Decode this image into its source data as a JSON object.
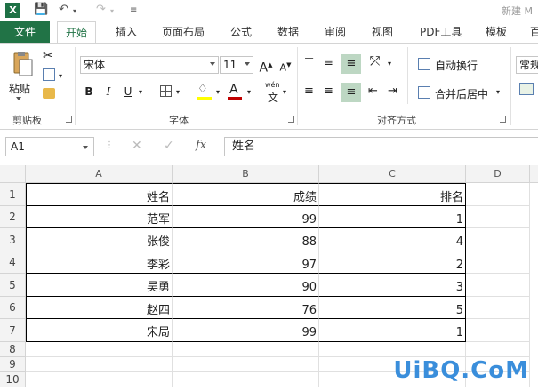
{
  "title": {
    "text": "新建 M"
  },
  "tabs": {
    "file": "文件",
    "home": "开始",
    "insert": "插入",
    "page_layout": "页面布局",
    "formulas": "公式",
    "data": "数据",
    "review": "审阅",
    "view": "视图",
    "pdf": "PDF工具",
    "template": "模板",
    "more": "百"
  },
  "ribbon": {
    "paste_label": "粘贴",
    "clipboard_group": "剪贴板",
    "font_name": "宋体",
    "font_size": "11",
    "font_group": "字体",
    "bold": "B",
    "italic": "I",
    "underline": "U",
    "wen_label": "wén",
    "wen_char": "文",
    "wrap_text": "自动换行",
    "merge_center": "合并后居中",
    "align_group": "对齐方式",
    "number_format": "常规",
    "grow_font": "A",
    "shrink_font": "A"
  },
  "formula_bar": {
    "name_box": "A1",
    "content": "姓名",
    "fx": "fx"
  },
  "columns": [
    "A",
    "B",
    "C",
    "D"
  ],
  "rows": [
    {
      "num": "1",
      "a": "姓名",
      "b": "成绩",
      "c": "排名"
    },
    {
      "num": "2",
      "a": "范军",
      "b": "99",
      "c": "1"
    },
    {
      "num": "3",
      "a": "张俊",
      "b": "88",
      "c": "4"
    },
    {
      "num": "4",
      "a": "李彩",
      "b": "97",
      "c": "2"
    },
    {
      "num": "5",
      "a": "吴勇",
      "b": "90",
      "c": "3"
    },
    {
      "num": "6",
      "a": "赵四",
      "b": "76",
      "c": "5"
    },
    {
      "num": "7",
      "a": "宋局",
      "b": "99",
      "c": "1"
    },
    {
      "num": "8",
      "a": "",
      "b": "",
      "c": ""
    },
    {
      "num": "9",
      "a": "",
      "b": "",
      "c": ""
    },
    {
      "num": "10",
      "a": "",
      "b": "",
      "c": ""
    }
  ],
  "watermark": "UiBQ.CoM",
  "colors": {
    "accent": "#217346",
    "highlight": "#bdd7c3",
    "font_color_bar": "#c00000",
    "fill_color_bar": "#ffff00"
  }
}
